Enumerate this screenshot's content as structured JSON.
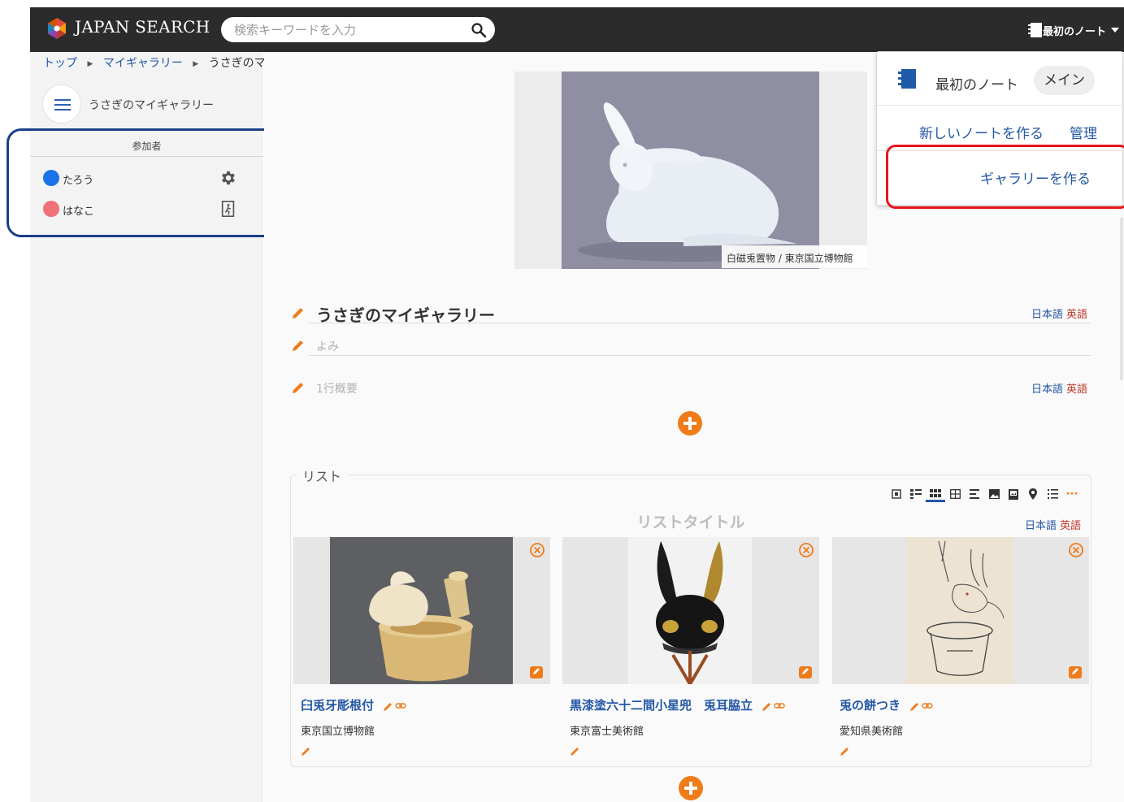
{
  "header": {
    "brand": "JAPAN SEARCH",
    "search_placeholder": "検索キーワードを入力",
    "note_button_label": "最初のノート"
  },
  "breadcrumb": {
    "items": [
      "トップ",
      "マイギャラリー",
      "うさぎのマイギャラリー"
    ]
  },
  "sidebar": {
    "gallery_title": "うさぎのマイギャラリー",
    "participants_heading": "参加者",
    "participants": [
      {
        "name": "たろう",
        "color": "#1a73e8",
        "icon": "gear-icon"
      },
      {
        "name": "はなこ",
        "color": "#f07178",
        "icon": "exit-door-icon"
      }
    ]
  },
  "hero": {
    "caption": "白磁兎置物 / 東京国立博物館"
  },
  "editor": {
    "title": "うさぎのマイギャラリー",
    "reading_placeholder": "よみ",
    "summary_placeholder": "1行概要",
    "lang_ja": "日本語",
    "lang_en": "英語"
  },
  "list": {
    "legend": "リスト",
    "title_placeholder": "リストタイトル",
    "lang_ja": "日本語",
    "lang_en": "英語",
    "more_label": "···",
    "items": [
      {
        "title": "臼兎牙彫根付",
        "institution": "東京国立博物館"
      },
      {
        "title": "黒漆塗六十二間小星兜　兎耳脇立",
        "institution": "東京富士美術館"
      },
      {
        "title": "兎の餅つき",
        "institution": "愛知県美術館"
      }
    ]
  },
  "dropdown": {
    "note_name": "最初のノート",
    "main_chip": "メイン",
    "new_note": "新しいノートを作る",
    "manage": "管理",
    "create_gallery": "ギャラリーを作る"
  },
  "colors": {
    "topbar": "#2b2b2b",
    "link_blue": "#2457a6",
    "accent_orange": "#f07b19",
    "english_red": "#c0392b",
    "highlight_red": "#e8141c",
    "highlight_navy": "#1b3f8a"
  }
}
